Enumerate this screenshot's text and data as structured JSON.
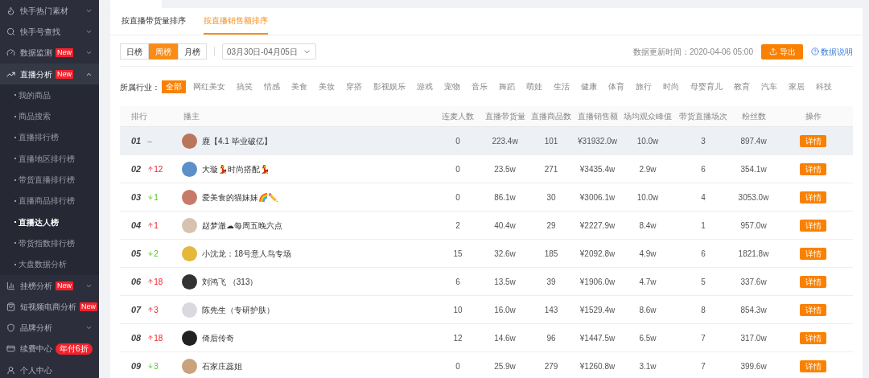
{
  "sidebar": {
    "items": [
      {
        "label": "快手热门素材",
        "expanded": false
      },
      {
        "label": "快手号查找",
        "expanded": false
      },
      {
        "label": "数据监测",
        "badge": {
          "text": "New",
          "kind": "tag"
        },
        "expanded": false
      },
      {
        "label": "直播分析",
        "badge": {
          "text": "New",
          "kind": "tag"
        },
        "expanded": true,
        "children": [
          {
            "label": "我的商品",
            "selected": false
          },
          {
            "label": "商品搜索",
            "selected": false
          },
          {
            "label": "直播排行榜",
            "selected": false
          },
          {
            "label": "直播地区排行榜",
            "selected": false
          },
          {
            "label": "带货直播排行榜",
            "selected": false
          },
          {
            "label": "直播商品排行榜",
            "selected": false
          },
          {
            "label": "直播达人榜",
            "selected": true
          },
          {
            "label": "带货指数排行榜",
            "selected": false
          },
          {
            "label": "大盘数据分析",
            "selected": false
          }
        ]
      },
      {
        "label": "挂榜分析",
        "badge": {
          "text": "New",
          "kind": "tag"
        },
        "expanded": false
      },
      {
        "label": "短视频电商分析",
        "badge": {
          "text": "New",
          "kind": "tag"
        },
        "expanded": false
      },
      {
        "label": "品牌分析",
        "expanded": false
      },
      {
        "label": "续费中心",
        "badge": {
          "text": "年付6折",
          "kind": "pill"
        }
      },
      {
        "label": "个人中心"
      }
    ]
  },
  "sort_tabs": [
    {
      "label": "按直播带货量排序",
      "selected": false
    },
    {
      "label": "按直播销售额排序",
      "selected": true
    }
  ],
  "period_tabs": [
    {
      "label": "日榜",
      "selected": false
    },
    {
      "label": "周榜",
      "selected": true
    },
    {
      "label": "月榜",
      "selected": false
    }
  ],
  "date_range": {
    "value": "03月30日-04月05日"
  },
  "update_time": "数据更新时间：2020-04-06 05:00",
  "export_button": "导出",
  "data_help_link": "数据说明",
  "industry": {
    "label": "所属行业：",
    "options": [
      {
        "label": "全部",
        "selected": true
      },
      {
        "label": "网红美女",
        "selected": false
      },
      {
        "label": "搞笑",
        "selected": false
      },
      {
        "label": "情感",
        "selected": false
      },
      {
        "label": "美食",
        "selected": false
      },
      {
        "label": "美妆",
        "selected": false
      },
      {
        "label": "穿搭",
        "selected": false
      },
      {
        "label": "影视娱乐",
        "selected": false
      },
      {
        "label": "游戏",
        "selected": false
      },
      {
        "label": "宠物",
        "selected": false
      },
      {
        "label": "音乐",
        "selected": false
      },
      {
        "label": "舞蹈",
        "selected": false
      },
      {
        "label": "萌娃",
        "selected": false
      },
      {
        "label": "生活",
        "selected": false
      },
      {
        "label": "健康",
        "selected": false
      },
      {
        "label": "体育",
        "selected": false
      },
      {
        "label": "旅行",
        "selected": false
      },
      {
        "label": "时尚",
        "selected": false
      },
      {
        "label": "母婴育儿",
        "selected": false
      },
      {
        "label": "教育",
        "selected": false
      },
      {
        "label": "汽车",
        "selected": false
      },
      {
        "label": "家居",
        "selected": false
      },
      {
        "label": "科技",
        "selected": false
      }
    ]
  },
  "table": {
    "columns": [
      "排行",
      "播主",
      "连麦人数",
      "直播带货量",
      "直播商品数",
      "直播销售额",
      "场均观众峰值",
      "带货直播场次",
      "粉丝数",
      "操作"
    ],
    "rows": [
      {
        "change": {
          "kind": "none",
          "text": "–"
        },
        "cells": [
          "01",
          "鹿【4.1 毕业破亿】",
          "0",
          "223.4w",
          "101",
          "¥31932.0w",
          "10.0w",
          "3",
          "897.4w",
          "详情"
        ],
        "selected": true
      },
      {
        "change": {
          "kind": "up",
          "text": "12"
        },
        "cells": [
          "02",
          "大璇💃时尚搭配💃",
          "0",
          "23.5w",
          "271",
          "¥3435.4w",
          "2.9w",
          "6",
          "354.1w",
          "详情"
        ],
        "selected": false
      },
      {
        "change": {
          "kind": "down",
          "text": "1"
        },
        "cells": [
          "03",
          "爱美食的猫妹妹🌈✏️",
          "0",
          "86.1w",
          "30",
          "¥3006.1w",
          "10.0w",
          "4",
          "3053.0w",
          "详情"
        ],
        "selected": false
      },
      {
        "change": {
          "kind": "up",
          "text": "1"
        },
        "cells": [
          "04",
          "赵梦澈☁每周五晚六点",
          "2",
          "40.4w",
          "29",
          "¥2227.9w",
          "8.4w",
          "1",
          "957.0w",
          "详情"
        ],
        "selected": false
      },
      {
        "change": {
          "kind": "down",
          "text": "2"
        },
        "cells": [
          "05",
          "小沈龙：18号意人鸟专场",
          "15",
          "32.6w",
          "185",
          "¥2092.8w",
          "4.9w",
          "6",
          "1821.8w",
          "详情"
        ],
        "selected": false
      },
      {
        "change": {
          "kind": "up",
          "text": "18"
        },
        "cells": [
          "06",
          "刘鸿飞 （313）",
          "6",
          "13.5w",
          "39",
          "¥1906.0w",
          "4.7w",
          "5",
          "337.6w",
          "详情"
        ],
        "selected": false
      },
      {
        "change": {
          "kind": "up",
          "text": "3"
        },
        "cells": [
          "07",
          "陈先生（专研护肤）",
          "10",
          "16.0w",
          "143",
          "¥1529.4w",
          "8.6w",
          "8",
          "854.3w",
          "详情"
        ],
        "selected": false
      },
      {
        "change": {
          "kind": "up",
          "text": "18"
        },
        "cells": [
          "08",
          "倚后传奇",
          "12",
          "14.6w",
          "96",
          "¥1447.5w",
          "6.5w",
          "7",
          "317.0w",
          "详情"
        ],
        "selected": false
      },
      {
        "change": {
          "kind": "down",
          "text": "3"
        },
        "cells": [
          "09",
          "石家庄蕊姐",
          "0",
          "25.9w",
          "279",
          "¥1260.8w",
          "3.1w",
          "7",
          "399.6w",
          "详情"
        ],
        "selected": false
      }
    ]
  }
}
